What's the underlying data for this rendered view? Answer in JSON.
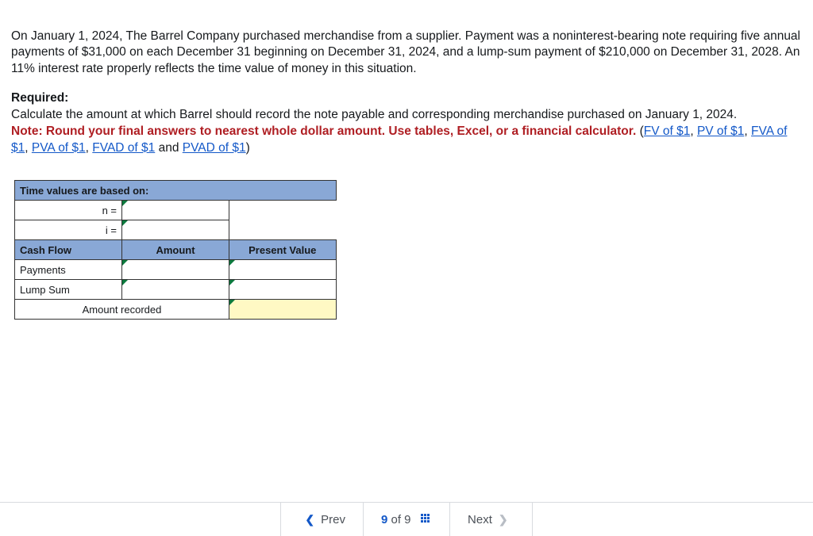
{
  "problem": {
    "para1": "On January 1, 2024, The Barrel Company purchased merchandise from a supplier. Payment was a noninterest-bearing note requiring five annual payments of $31,000 on each December 31 beginning on December 31, 2024, and a lump-sum payment of $210,000 on December 31, 2028. An 11% interest rate properly reflects the time value of money in this situation.",
    "required_label": "Required:",
    "required_text": "Calculate the amount at which Barrel should record the note payable and corresponding merchandise purchased on January 1, 2024.",
    "note_bold": "Note: Round your final answers to nearest whole dollar amount. Use tables, Excel, or a financial calculator.",
    "open_paren": " (",
    "links": {
      "fv": "FV of $1",
      "pv": "PV of $1",
      "fva": "FVA of $1",
      "pva": "PVA of $1",
      "fvad": "FVAD of $1",
      "pvad": "PVAD of $1"
    },
    "sep_comma": ", ",
    "sep_and": " and ",
    "close_paren": ")"
  },
  "table": {
    "title": "Time values are based on:",
    "n_label": "n =",
    "i_label": "i =",
    "col_cashflow": "Cash Flow",
    "col_amount": "Amount",
    "col_pv": "Present Value",
    "row_payments": "Payments",
    "row_lump": "Lump Sum",
    "row_recorded": "Amount recorded",
    "inputs": {
      "n": "",
      "i": "",
      "payments_amount": "",
      "payments_pv": "",
      "lump_amount": "",
      "lump_pv": "",
      "recorded": ""
    }
  },
  "nav": {
    "prev": "Prev",
    "next": "Next",
    "current": "9",
    "of": "of",
    "total": "9"
  }
}
